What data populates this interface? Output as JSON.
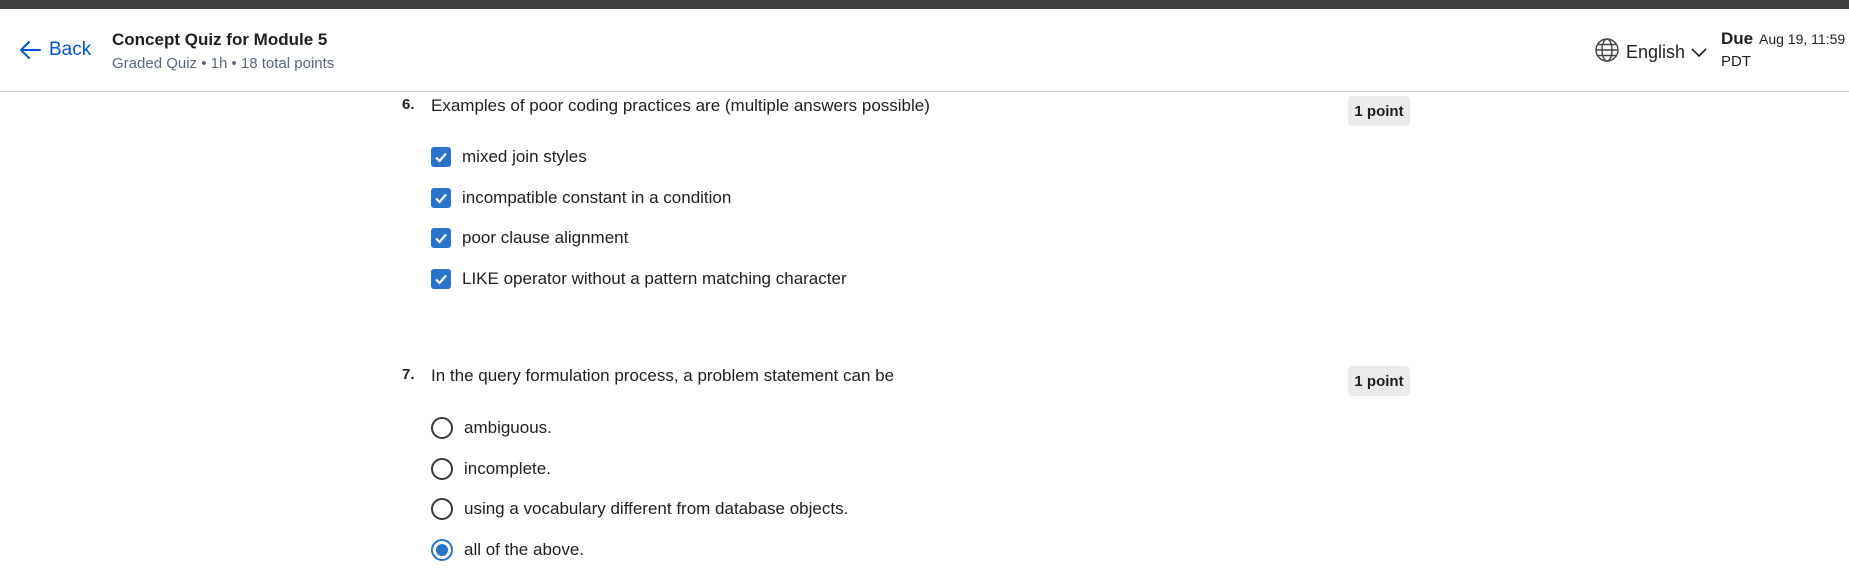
{
  "header": {
    "back_label": "Back",
    "title": "Concept Quiz for Module 5",
    "subtitle": "Graded Quiz • 1h • 18 total points",
    "language": "English",
    "due_label": "Due",
    "due_date": "Aug 19, 11:59",
    "due_tz": "PDT"
  },
  "questions": [
    {
      "number": "6.",
      "text": "Examples of poor coding practices are (multiple answers possible)",
      "points": "1 point",
      "type": "checkbox",
      "options": [
        {
          "label": "mixed join styles",
          "checked": true
        },
        {
          "label": "incompatible constant in a condition",
          "checked": true
        },
        {
          "label": "poor clause alignment",
          "checked": true
        },
        {
          "label": "LIKE operator without a pattern matching character",
          "checked": true
        }
      ]
    },
    {
      "number": "7.",
      "text": "In the query formulation process, a problem statement can be",
      "points": "1 point",
      "type": "radio",
      "options": [
        {
          "label": "ambiguous.",
          "checked": false
        },
        {
          "label": "incomplete.",
          "checked": false
        },
        {
          "label": "using a vocabulary different from database objects.",
          "checked": false
        },
        {
          "label": "all of the above.",
          "checked": true
        }
      ]
    }
  ],
  "colors": {
    "accent": "#0056d2",
    "control": "#2a73cc"
  }
}
